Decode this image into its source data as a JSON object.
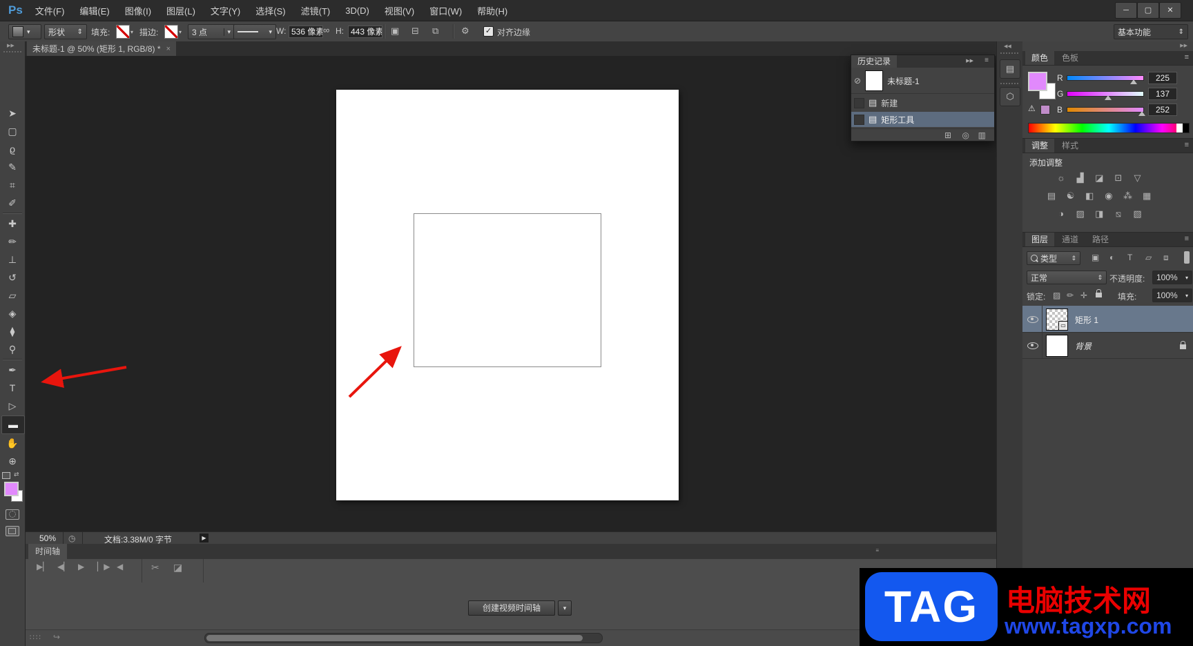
{
  "menu_bar": {
    "logo": "Ps",
    "items": [
      "文件(F)",
      "编辑(E)",
      "图像(I)",
      "图层(L)",
      "文字(Y)",
      "选择(S)",
      "滤镜(T)",
      "3D(D)",
      "视图(V)",
      "窗口(W)",
      "帮助(H)"
    ]
  },
  "window_controls": {
    "minimize": "─",
    "maximize": "▢",
    "close": "✕"
  },
  "options_bar": {
    "tool_mode_value": "形状",
    "fill_label": "填充:",
    "stroke_label": "描边:",
    "stroke_width_value": "3 点",
    "width_label": "W:",
    "width_value": "536 像素",
    "height_label": "H:",
    "height_value": "443 像素",
    "align_edges_label": "对齐边缘",
    "workspace_label": "基本功能"
  },
  "document_tab": {
    "title": "未标题-1 @ 50% (矩形 1, RGB/8) *"
  },
  "toolbar": {
    "tools": [
      {
        "name": "move-tool",
        "glyph": "➤"
      },
      {
        "name": "rectangular-marquee-tool",
        "glyph": "▢"
      },
      {
        "name": "lasso-tool",
        "glyph": "ϱ"
      },
      {
        "name": "quick-selection-tool",
        "glyph": "✎"
      },
      {
        "name": "crop-tool",
        "glyph": "⌗"
      },
      {
        "name": "eyedropper-tool",
        "glyph": "✐"
      },
      {
        "name": "spot-healing-brush-tool",
        "glyph": "✚"
      },
      {
        "name": "brush-tool",
        "glyph": "✏"
      },
      {
        "name": "clone-stamp-tool",
        "glyph": "⊥"
      },
      {
        "name": "history-brush-tool",
        "glyph": "↺"
      },
      {
        "name": "eraser-tool",
        "glyph": "▱"
      },
      {
        "name": "paint-bucket-tool",
        "glyph": "◈"
      },
      {
        "name": "blur-tool",
        "glyph": "⧫"
      },
      {
        "name": "dodge-tool",
        "glyph": "⚲"
      },
      {
        "name": "pen-tool",
        "glyph": "✒"
      },
      {
        "name": "type-tool",
        "glyph": "T"
      },
      {
        "name": "path-selection-tool",
        "glyph": "▷"
      },
      {
        "name": "rectangle-tool",
        "glyph": "▬",
        "selected": true
      },
      {
        "name": "hand-tool",
        "glyph": "✋"
      },
      {
        "name": "zoom-tool",
        "glyph": "⊕"
      }
    ],
    "foreground_color": "#e189fc",
    "background_color": "#ffffff"
  },
  "history_panel": {
    "title": "历史记录",
    "snapshot_name": "未标题-1",
    "entries": [
      {
        "label": "新建",
        "selected": false
      },
      {
        "label": "矩形工具",
        "selected": true
      }
    ]
  },
  "color_panel": {
    "tab_color": "颜色",
    "tab_swatches": "色板",
    "channels": [
      {
        "label": "R",
        "value": "225"
      },
      {
        "label": "G",
        "value": "137"
      },
      {
        "label": "B",
        "value": "252"
      }
    ],
    "foreground_color": "#e189fc"
  },
  "adjustments_panel": {
    "tab_adjustments": "调整",
    "tab_styles": "样式",
    "heading": "添加调整",
    "icons": [
      {
        "name": "brightness-contrast",
        "glyph": "☼"
      },
      {
        "name": "levels",
        "glyph": "▟"
      },
      {
        "name": "curves",
        "glyph": "◪"
      },
      {
        "name": "exposure",
        "glyph": "⊡"
      },
      {
        "name": "vibrance",
        "glyph": "▽"
      },
      {
        "name": "hue-saturation",
        "glyph": "▤"
      },
      {
        "name": "color-balance",
        "glyph": "☯"
      },
      {
        "name": "black-white",
        "glyph": "◧"
      },
      {
        "name": "photo-filter",
        "glyph": "◉"
      },
      {
        "name": "channel-mixer",
        "glyph": "⁂"
      },
      {
        "name": "color-lookup",
        "glyph": "▦"
      },
      {
        "name": "invert",
        "glyph": "◑"
      },
      {
        "name": "posterize",
        "glyph": "▨"
      },
      {
        "name": "threshold",
        "glyph": "◨"
      },
      {
        "name": "gradient-map",
        "glyph": "⧅"
      },
      {
        "name": "selective-color",
        "glyph": "▧"
      }
    ]
  },
  "layers_panel": {
    "tab_layers": "图层",
    "tab_channels": "通道",
    "tab_paths": "路径",
    "filter_type_value": "类型",
    "blend_mode_value": "正常",
    "opacity_label": "不透明度:",
    "opacity_value": "100%",
    "lock_label": "锁定:",
    "fill_label": "填充:",
    "fill_value": "100%",
    "layers": [
      {
        "name": "矩形 1",
        "selected": true,
        "locked": false
      },
      {
        "name": "背景",
        "selected": false,
        "locked": true
      }
    ]
  },
  "status_bar": {
    "zoom_value": "50%",
    "document_info": "文档:3.38M/0 字节"
  },
  "timeline_panel": {
    "tab": "时间轴",
    "create_button_label": "创建视频时间轴"
  },
  "watermark": {
    "badge": "TAG",
    "title": "电脑技术网",
    "url": "www.tagxp.com"
  },
  "icons": {
    "menu": "≡",
    "chevrons_right": "▶▶",
    "chevrons_left": "◀◀",
    "dropdown": "▾",
    "spinner": "⇕",
    "link": "∞",
    "gear": "⚙",
    "check": "✓",
    "close": "×",
    "scissors": "✂",
    "transition": "◪",
    "clock": "◷",
    "proof_arrow": "▶",
    "new_state": "⊞",
    "snapshot_camera": "◎",
    "trash": "▥",
    "doc": "▤",
    "history_source": "⊘",
    "grid": "∷∷",
    "flip_arrow": "↪",
    "warning": "⚠",
    "pathops": "▣",
    "align": "⊟",
    "arrange": "⧉",
    "strip_btn1": "▤",
    "strip_btn2": "⬡",
    "transport": [
      "▶▏",
      "◀▏",
      "▶",
      "▏▶",
      "◀"
    ],
    "filter_kinds": [
      "▣",
      "◐",
      "T",
      "▱",
      "⧈"
    ],
    "lock_row": [
      "▨",
      "✏",
      "✛"
    ]
  },
  "colors": {
    "selection_layer": "#68788c",
    "selection_history": "#5d6c7f",
    "arrow_red": "#e8150d",
    "foreground": "#e189fc"
  }
}
